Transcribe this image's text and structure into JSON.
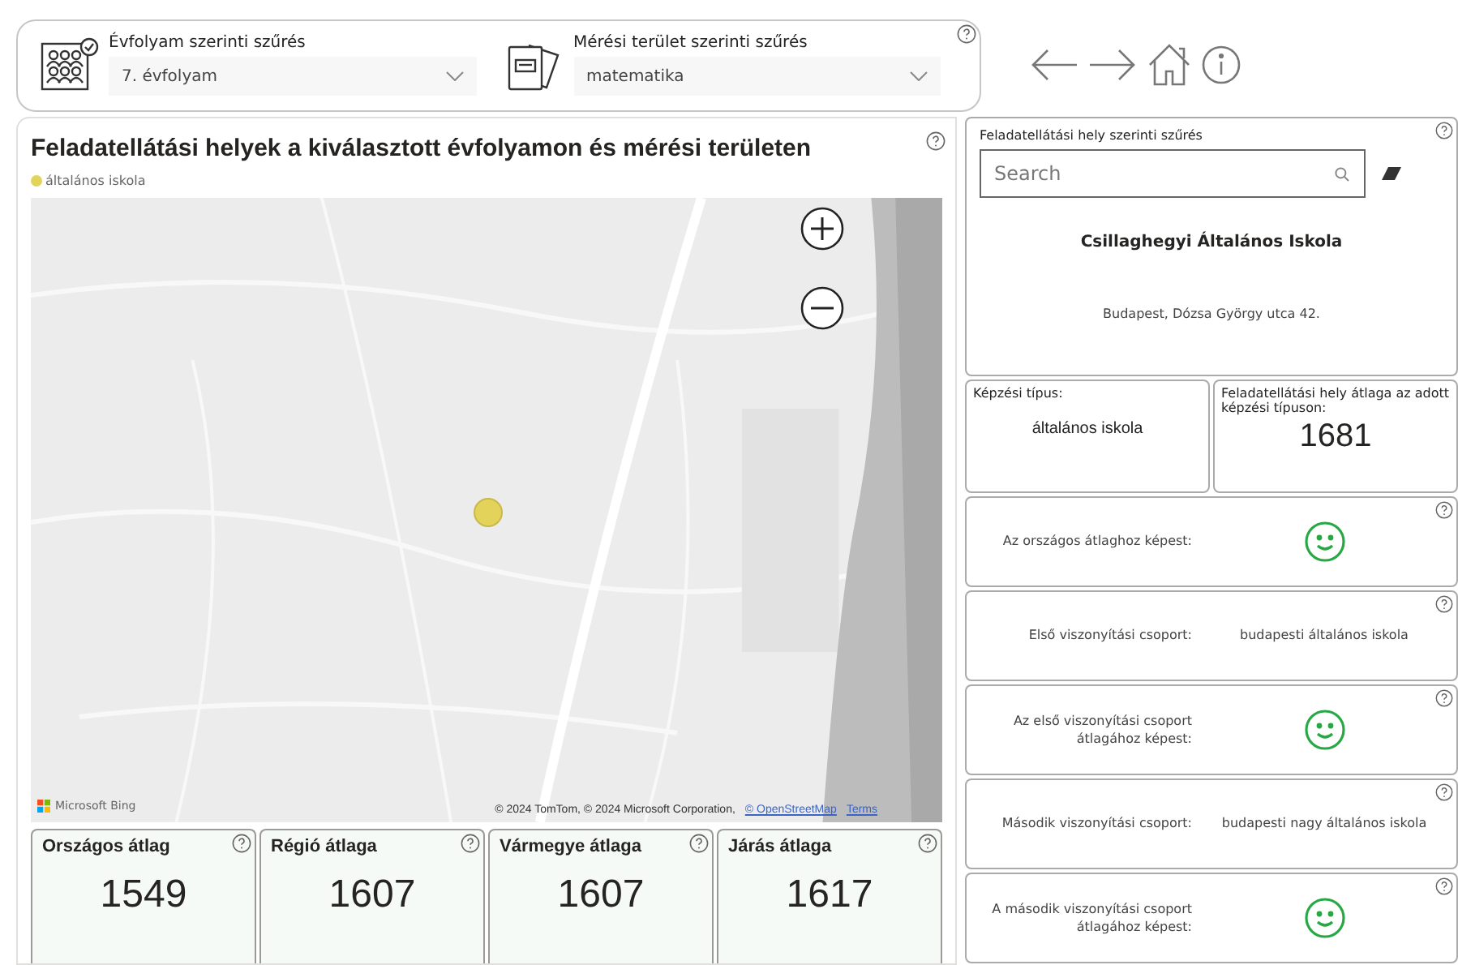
{
  "filters": [
    {
      "kind": "grade",
      "label": "Évfolyam szerinti szűrés",
      "value": "7. évfolyam"
    },
    {
      "kind": "subject",
      "label": "Mérési terület szerinti szűrés",
      "value": "matematika"
    }
  ],
  "map_panel": {
    "title": "Feladatellátási helyek a kiválasztott évfolyamon és mérési területen",
    "legend": [
      {
        "label": "általános iskola",
        "color": "#e3d35a"
      }
    ],
    "provider": "Microsoft Bing",
    "attribution": "© 2024 TomTom, © 2024 Microsoft Corporation,",
    "links": [
      "© OpenStreetMap",
      "Terms"
    ]
  },
  "stats": [
    {
      "title": "Országos átlag",
      "value": "1549"
    },
    {
      "title": "Régió átlaga",
      "value": "1607"
    },
    {
      "title": "Vármegye átlaga",
      "value": "1607"
    },
    {
      "title": "Járás átlaga",
      "value": "1617"
    }
  ],
  "school_panel": {
    "title": "Feladatellátási hely szerinti szűrés",
    "placeholder": "Search",
    "name": "Csillaghegyi Általános Iskola",
    "address": "Budapest, Dózsa György utca 42.",
    "training_type": {
      "label": "Képzési típus:",
      "value": "általános iskola"
    },
    "school_average": {
      "label": "Feladatellátási hely átlaga az adott képzési típuson:",
      "value": "1681"
    },
    "rows": [
      {
        "kind": "smiley",
        "label": "Az országos átlaghoz képest:"
      },
      {
        "kind": "text",
        "label": "Első viszonyítási csoport:",
        "value": "budapesti általános iskola"
      },
      {
        "kind": "smiley",
        "label": "Az első viszonyítási csoport átlagához képest:"
      },
      {
        "kind": "text",
        "label": "Második viszonyítási csoport:",
        "value": "budapesti nagy általános iskola"
      },
      {
        "kind": "smiley",
        "label": "A második viszonyítási csoport átlagához képest:"
      }
    ]
  }
}
